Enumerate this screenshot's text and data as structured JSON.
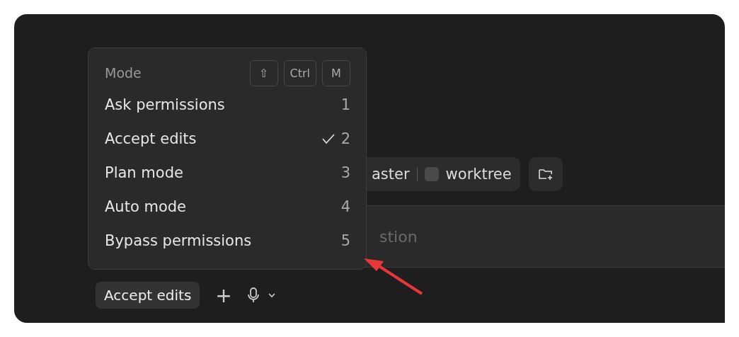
{
  "toolbar": {
    "branch": "aster",
    "worktree": "worktree"
  },
  "prompt": {
    "placeholder": "stion"
  },
  "bottom_bar": {
    "mode_button": "Accept edits",
    "add": "+"
  },
  "mode_menu": {
    "title": "Mode",
    "shortcut_keys": [
      "⇧",
      "Ctrl",
      "M"
    ],
    "items": [
      {
        "label": "Ask permissions",
        "key": "1",
        "selected": false
      },
      {
        "label": "Accept edits",
        "key": "2",
        "selected": true
      },
      {
        "label": "Plan mode",
        "key": "3",
        "selected": false
      },
      {
        "label": "Auto mode",
        "key": "4",
        "selected": false
      },
      {
        "label": "Bypass permissions",
        "key": "5",
        "selected": false
      }
    ]
  }
}
